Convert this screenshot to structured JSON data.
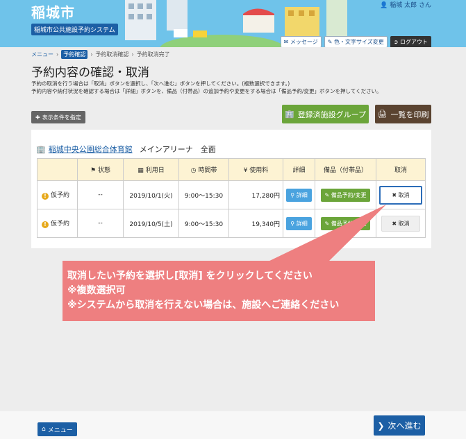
{
  "header": {
    "site_title": "稲城市",
    "system_name": "稲城市公共施設予約システム",
    "user_name": "稲城 太郎 さん",
    "buttons": {
      "message": "メッセージ",
      "display": "色・文字サイズ変更",
      "logout": "ログアウト"
    }
  },
  "breadcrumb": {
    "items": [
      "メニュー",
      "予約確認",
      "予約取消確認",
      "予約取消完了"
    ]
  },
  "page_title": "予約内容の確認・取消",
  "description": {
    "line1": "予約の取消を行う場合は「取消」ボタンを選択し、「次へ進む」ボタンを押してください。(複数選択できます。)",
    "line2": "予約内容や納付状況を確認する場合は「詳細」ボタンを、備品（付帯品）の追加予約や変更をする場合は「備品予約/変更」ボタンを押してください。"
  },
  "toolbar": {
    "filter": "表示条件を指定",
    "registered_group": "登録済施設グループ",
    "print": "一覧を印刷"
  },
  "facility": {
    "name": "稲城中央公園総合体育館",
    "room": "メインアリーナ　全面"
  },
  "table": {
    "headers": {
      "status": "状態",
      "date": "利用日",
      "time": "時間帯",
      "fee": "使用料",
      "detail": "詳細",
      "equipment": "備品（付帯品）",
      "cancel": "取消"
    },
    "rows": [
      {
        "reservation": "仮予約",
        "status": "--",
        "date": "2019/10/1(火)",
        "time": "9:00～15:30",
        "fee": "17,280円",
        "detail": "詳細",
        "equipment": "備品予約/変更",
        "cancel": "取消"
      },
      {
        "reservation": "仮予約",
        "status": "--",
        "date": "2019/10/5(土)",
        "time": "9:00～15:30",
        "fee": "19,340円",
        "detail": "詳細",
        "equipment": "備品予約/変更",
        "cancel": "取消"
      }
    ]
  },
  "callout": {
    "line1": "取消したい予約を選択し[取消] をクリックしてください",
    "line2": "※複数選択可",
    "line3": "※システムから取消を行えない場合は、施設へご連絡ください"
  },
  "footer": {
    "menu": "メニュー",
    "next": "次へ進む"
  },
  "colors": {
    "header": "#6fc3ea",
    "brand_blue": "#1c5fa5",
    "green": "#6ba53a",
    "callout": "#ee7f80",
    "print": "#5a4330"
  }
}
